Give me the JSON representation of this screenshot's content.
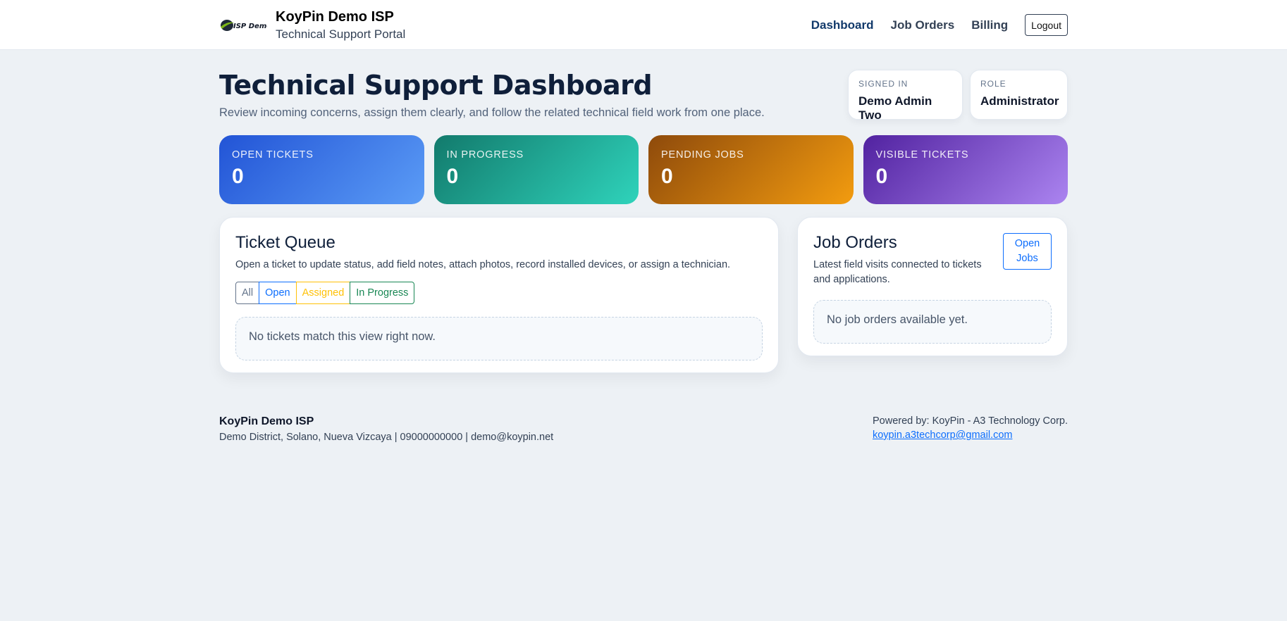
{
  "header": {
    "logo_text": "ISP Demo",
    "brand_name": "KoyPin Demo ISP",
    "brand_sub": "Technical Support Portal",
    "nav": [
      {
        "label": "Dashboard"
      },
      {
        "label": "Job Orders"
      },
      {
        "label": "Billing"
      }
    ],
    "logout_label": "Logout"
  },
  "hero": {
    "title": "Technical Support Dashboard",
    "subtitle": "Review incoming concerns, assign them clearly, and follow the related technical field work from one place.",
    "signed_in_label": "SIGNED IN",
    "signed_in_value": "Demo Admin Two",
    "role_label": "ROLE",
    "role_value": "Administrator"
  },
  "stats": [
    {
      "label": "OPEN TICKETS",
      "value": "0"
    },
    {
      "label": "IN PROGRESS",
      "value": "0"
    },
    {
      "label": "PENDING JOBS",
      "value": "0"
    },
    {
      "label": "VISIBLE TICKETS",
      "value": "0"
    }
  ],
  "queue": {
    "title": "Ticket Queue",
    "description": "Open a ticket to update status, add field notes, attach photos, record installed devices, or assign a technician.",
    "filters": [
      {
        "label": "All"
      },
      {
        "label": "Open"
      },
      {
        "label": "Assigned"
      },
      {
        "label": "In Progress"
      }
    ],
    "empty_message": "No tickets match this view right now."
  },
  "jobs": {
    "title": "Job Orders",
    "description": "Latest field visits connected to tickets and applications.",
    "open_button": "Open Jobs",
    "empty_message": "No job orders available yet."
  },
  "footer": {
    "company": "KoyPin Demo ISP",
    "address": "Demo District, Solano, Nueva Vizcaya | 09000000000 | demo@koypin.net",
    "powered_by": "Powered by: KoyPin - A3 Technology Corp.",
    "email": "koypin.a3techcorp@gmail.com"
  },
  "colors": {
    "accent_blue": "#0d6efd",
    "nav_active": "#123a6b",
    "stat_blue": "#2254d6",
    "stat_teal": "#127a6c",
    "stat_amber": "#f39c0f",
    "stat_purple": "#5122a0"
  }
}
